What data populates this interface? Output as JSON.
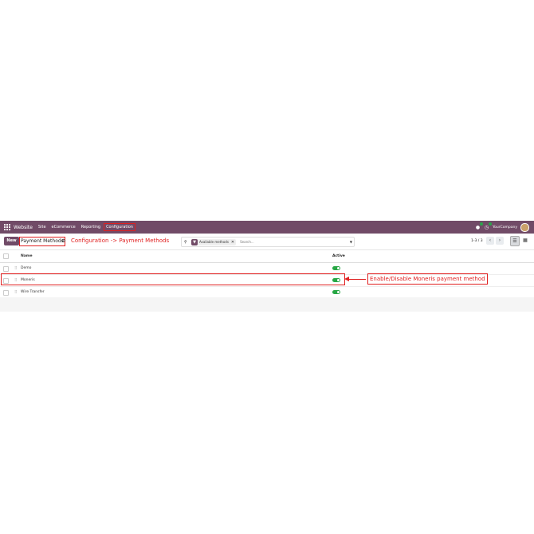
{
  "navbar": {
    "brand": "Website",
    "menu": [
      "Site",
      "eCommerce",
      "Reporting",
      "Configuration"
    ],
    "company": "YourCompany",
    "colors": {
      "bar": "#714B67",
      "badge": "#2ba44b"
    }
  },
  "control": {
    "new_label": "New",
    "title": "Payment Methods",
    "annotation": "Configuration -> Payment Methods",
    "facet_label": "Available methods",
    "search_placeholder": "Search...",
    "pager": "1-3 / 3"
  },
  "table": {
    "headers": {
      "name": "Name",
      "active": "Active"
    },
    "rows": [
      {
        "name": "Demo",
        "active": true
      },
      {
        "name": "Moneris",
        "active": true
      },
      {
        "name": "Wire Transfer",
        "active": true
      }
    ]
  },
  "annotation_row": "Enable/Disable Moneris payment method",
  "icons": {
    "apps": "apps-grid-icon",
    "search": "search-icon",
    "settings": "gear-icon",
    "filter": "filter-icon",
    "list_view": "list-view-icon",
    "kanban_view": "kanban-view-icon"
  }
}
